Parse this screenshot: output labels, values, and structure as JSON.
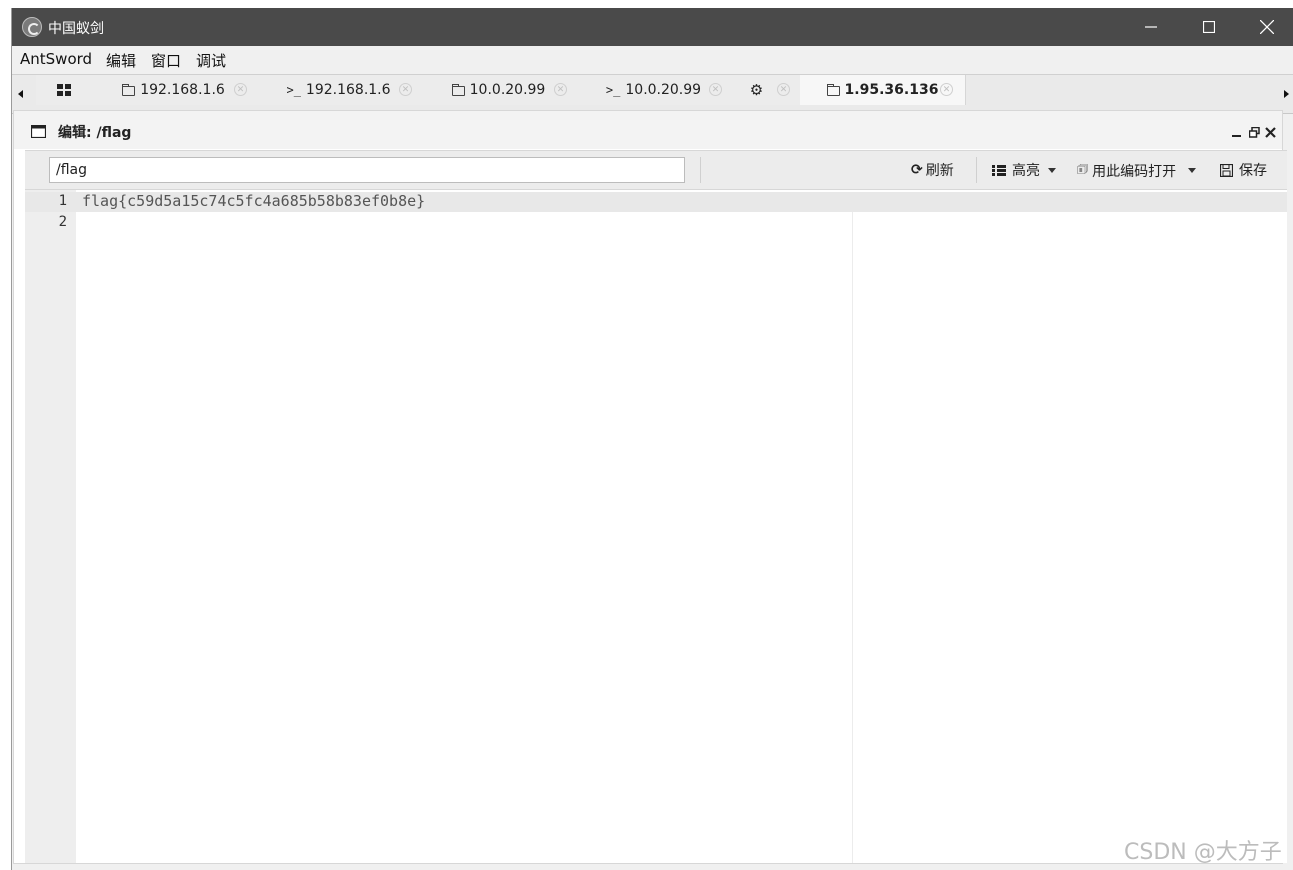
{
  "window": {
    "title": "中国蚁剑",
    "app_icon": "antsword-logo-icon",
    "controls": [
      "minimize",
      "maximize",
      "close"
    ]
  },
  "menu": {
    "items": [
      "AntSword",
      "编辑",
      "窗口",
      "调试"
    ]
  },
  "tabs": [
    {
      "label": "",
      "icon": "grid-icon"
    },
    {
      "label": "192.168.1.6",
      "icon": "folder-icon"
    },
    {
      "label": "192.168.1.6",
      "icon": "terminal-icon"
    },
    {
      "label": "10.0.20.99",
      "icon": "folder-icon"
    },
    {
      "label": "10.0.20.99",
      "icon": "terminal-icon"
    },
    {
      "label": "",
      "icon": "gear-icon"
    },
    {
      "label": "1.95.36.136",
      "icon": "folder-icon",
      "active": true
    }
  ],
  "panel": {
    "title": "编辑: /flag",
    "path_value": "/flag",
    "toolbar": {
      "refresh": "刷新",
      "highlight": "高亮",
      "open_with_encoding": "用此编码打开",
      "save": "保存"
    }
  },
  "editor": {
    "line_numbers": [
      "1",
      "2"
    ],
    "lines": [
      "flag{c59d5a15c74c5fc4a685b58b83ef0b8e}",
      ""
    ]
  },
  "watermark": "CSDN @大方子"
}
